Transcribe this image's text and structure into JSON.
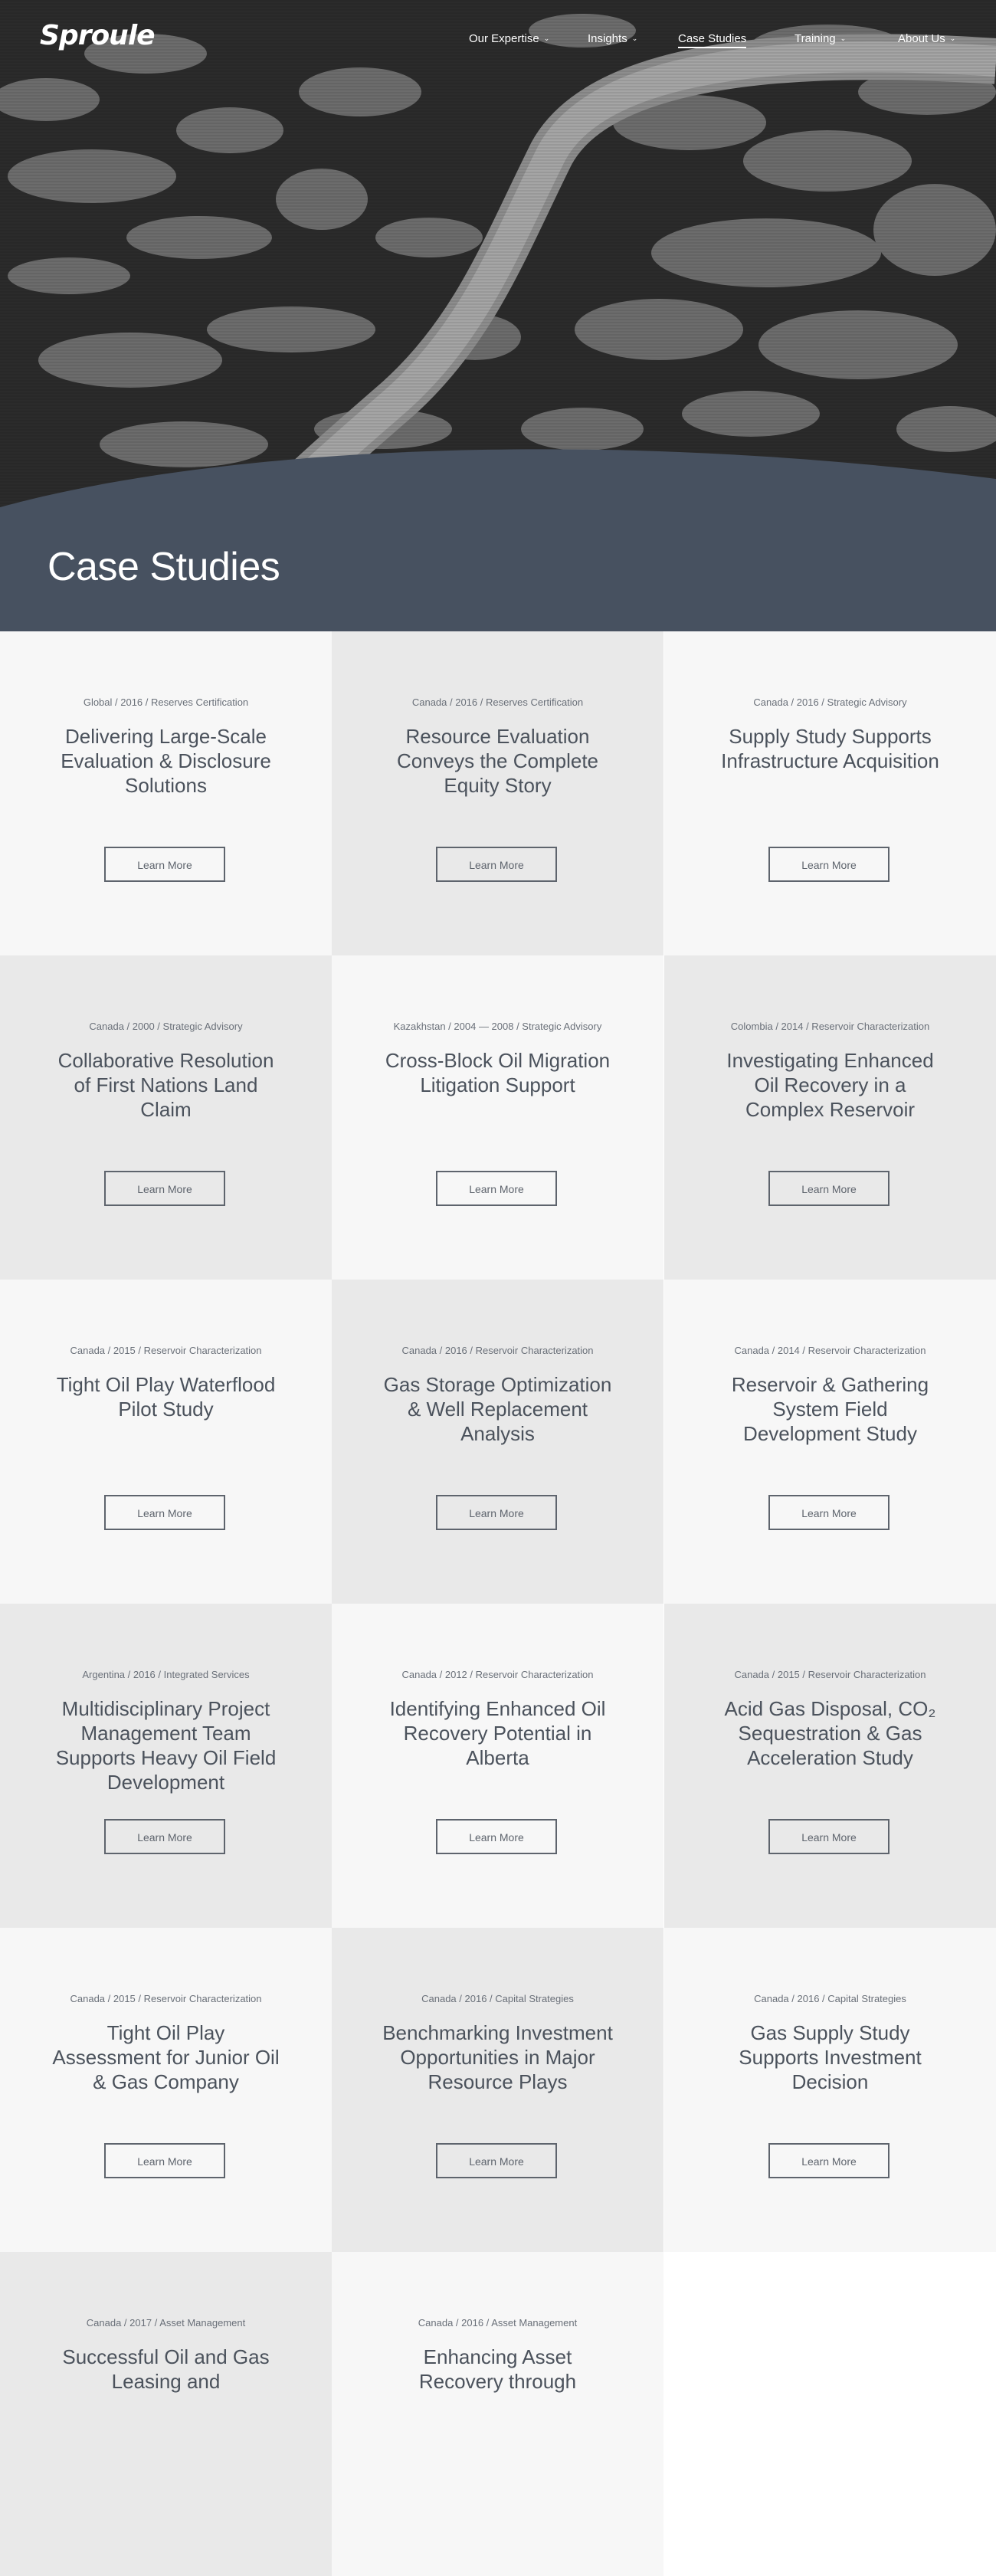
{
  "brand": {
    "logo": "Sproule"
  },
  "nav": {
    "items": [
      {
        "label": "Our Expertise",
        "dropdown": true
      },
      {
        "label": "Insights",
        "dropdown": true
      },
      {
        "label": "Case Studies",
        "dropdown": false,
        "active": true
      },
      {
        "label": "Training",
        "dropdown": true
      },
      {
        "label": "About Us",
        "dropdown": true
      }
    ],
    "chevron": "⌄"
  },
  "hero": {
    "title": "Case Studies",
    "band_color": "#475160"
  },
  "cards": [
    {
      "meta": "Global / 2016 / Reserves Certification",
      "title": "Delivering Large-Scale Evaluation & Disclosure Solutions",
      "button": "Learn More"
    },
    {
      "meta": "Canada / 2016 / Reserves Certification",
      "title": "Resource Evaluation Conveys the Complete Equity Story",
      "button": "Learn More"
    },
    {
      "meta": "Canada / 2016 / Strategic Advisory",
      "title": "Supply Study Supports Infrastructure Acquisition",
      "button": "Learn More"
    },
    {
      "meta": "Canada / 2000 / Strategic Advisory",
      "title": "Collaborative Resolution of First Nations Land Claim",
      "button": "Learn More"
    },
    {
      "meta": "Kazakhstan / 2004 — 2008 / Strategic Advisory",
      "title": "Cross-Block Oil Migration Litigation Support",
      "button": "Learn More"
    },
    {
      "meta": "Colombia / 2014 / Reservoir Characterization",
      "title": "Investigating Enhanced Oil Recovery in a Complex Reservoir",
      "button": "Learn More"
    },
    {
      "meta": "Canada / 2015 / Reservoir Characterization",
      "title": "Tight Oil Play Waterflood Pilot Study",
      "button": "Learn More"
    },
    {
      "meta": "Canada / 2016 / Reservoir Characterization",
      "title": "Gas Storage Optimization & Well Replacement Analysis",
      "button": "Learn More"
    },
    {
      "meta": "Canada / 2014 / Reservoir Characterization",
      "title": "Reservoir & Gathering System Field Development Study",
      "button": "Learn More"
    },
    {
      "meta": "Argentina / 2016 / Integrated Services",
      "title": "Multidisciplinary Project Management Team Supports Heavy Oil Field Development",
      "button": "Learn More"
    },
    {
      "meta": "Canada / 2012 / Reservoir Characterization",
      "title": "Identifying Enhanced Oil Recovery Potential in Alberta",
      "button": "Learn More"
    },
    {
      "meta": "Canada / 2015 / Reservoir Characterization",
      "title": "Acid Gas Disposal, CO₂ Sequestration & Gas Acceleration Study",
      "button": "Learn More"
    },
    {
      "meta": "Canada / 2015 / Reservoir Characterization",
      "title": "Tight Oil Play Assessment for Junior Oil & Gas Company",
      "button": "Learn More"
    },
    {
      "meta": "Canada / 2016 / Capital Strategies",
      "title": "Benchmarking Investment Opportunities in Major Resource Plays",
      "button": "Learn More"
    },
    {
      "meta": "Canada / 2016 / Capital Strategies",
      "title": "Gas Supply Study Supports Investment Decision",
      "button": "Learn More"
    },
    {
      "meta": "Canada / 2017 / Asset Management",
      "title": "Successful Oil and Gas Leasing and",
      "button": ""
    },
    {
      "meta": "Canada / 2016 / Asset Management",
      "title": "Enhancing Asset Recovery through",
      "button": ""
    }
  ]
}
